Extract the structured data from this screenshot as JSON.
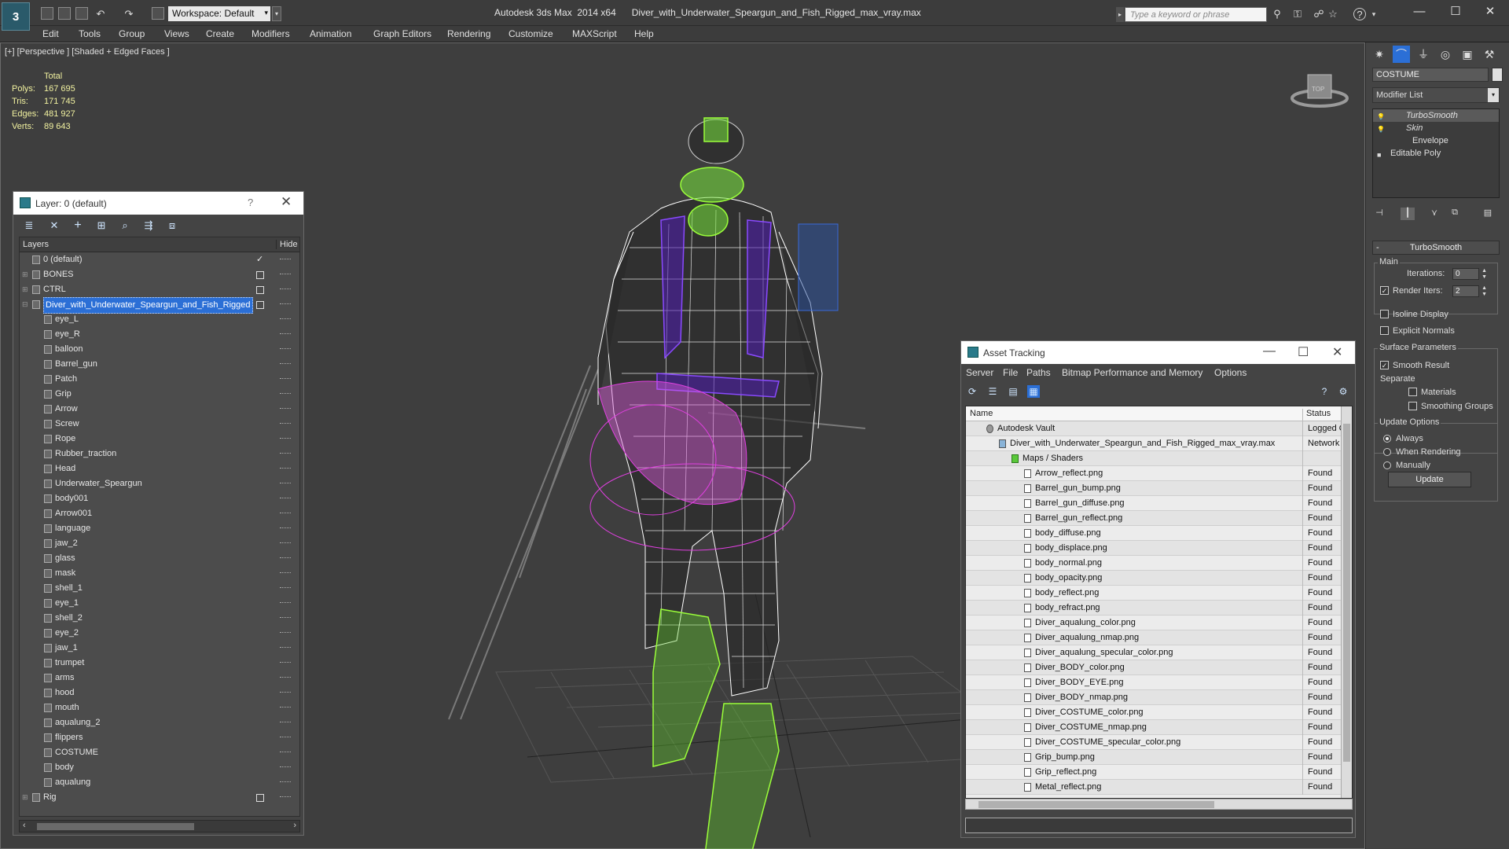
{
  "titlebar": {
    "app_title": "Autodesk 3ds Max  2014 x64      Diver_with_Underwater_Speargun_and_Fish_Rigged_max_vray.max",
    "workspace": "Workspace: Default",
    "search_placeholder": "Type a keyword or phrase",
    "logo": "3"
  },
  "menu": [
    "Edit",
    "Tools",
    "Group",
    "Views",
    "Create",
    "Modifiers",
    "Animation",
    "Graph Editors",
    "Rendering",
    "Customize",
    "MAXScript",
    "Help"
  ],
  "viewport": {
    "label": "[+] [Perspective ] [Shaded + Edged Faces ]",
    "stats": {
      "header": "Total",
      "rows": [
        {
          "k": "Polys:",
          "v": "167 695"
        },
        {
          "k": "Tris:",
          "v": "171 745"
        },
        {
          "k": "Edges:",
          "v": "481 927"
        },
        {
          "k": "Verts:",
          "v": "89 643"
        }
      ]
    },
    "viewcube_label": "TOP"
  },
  "layer_panel": {
    "title": "Layer: 0 (default)",
    "help": "?",
    "col_layers": "Layers",
    "col_hide": "Hide",
    "rows": [
      {
        "name": "0 (default)",
        "level": 0,
        "exp": "",
        "mark": "check"
      },
      {
        "name": "BONES",
        "level": 0,
        "exp": "+",
        "mark": "box"
      },
      {
        "name": "CTRL",
        "level": 0,
        "exp": "+",
        "mark": "box"
      },
      {
        "name": "Diver_with_Underwater_Speargun_and_Fish_Rigged",
        "level": 0,
        "exp": "-",
        "mark": "box",
        "selected": true
      },
      {
        "name": "eye_L",
        "level": 1
      },
      {
        "name": "eye_R",
        "level": 1
      },
      {
        "name": "balloon",
        "level": 1
      },
      {
        "name": "Barrel_gun",
        "level": 1
      },
      {
        "name": "Patch",
        "level": 1
      },
      {
        "name": "Grip",
        "level": 1
      },
      {
        "name": "Arrow",
        "level": 1
      },
      {
        "name": "Screw",
        "level": 1
      },
      {
        "name": "Rope",
        "level": 1
      },
      {
        "name": "Rubber_traction",
        "level": 1
      },
      {
        "name": "Head",
        "level": 1
      },
      {
        "name": "Underwater_Speargun",
        "level": 1
      },
      {
        "name": "body001",
        "level": 1
      },
      {
        "name": "Arrow001",
        "level": 1
      },
      {
        "name": "language",
        "level": 1
      },
      {
        "name": "jaw_2",
        "level": 1
      },
      {
        "name": "glass",
        "level": 1
      },
      {
        "name": "mask",
        "level": 1
      },
      {
        "name": "shell_1",
        "level": 1
      },
      {
        "name": "eye_1",
        "level": 1
      },
      {
        "name": "shell_2",
        "level": 1
      },
      {
        "name": "eye_2",
        "level": 1
      },
      {
        "name": "jaw_1",
        "level": 1
      },
      {
        "name": "trumpet",
        "level": 1
      },
      {
        "name": "arms",
        "level": 1
      },
      {
        "name": "hood",
        "level": 1
      },
      {
        "name": "mouth",
        "level": 1
      },
      {
        "name": "aqualung_2",
        "level": 1
      },
      {
        "name": "flippers",
        "level": 1
      },
      {
        "name": "COSTUME",
        "level": 1
      },
      {
        "name": "body",
        "level": 1
      },
      {
        "name": "aqualung",
        "level": 1
      },
      {
        "name": "Rig",
        "level": 0,
        "exp": "+",
        "mark": "box"
      }
    ]
  },
  "asset_panel": {
    "title": "Asset Tracking",
    "menu": [
      "Server",
      "File",
      "Paths",
      "Bitmap Performance and Memory",
      "Options"
    ],
    "col_name": "Name",
    "col_status": "Status",
    "rows": [
      {
        "name": "Autodesk Vault",
        "indent": 1,
        "status": "Logged O",
        "kind": "vault"
      },
      {
        "name": "Diver_with_Underwater_Speargun_and_Fish_Rigged_max_vray.max",
        "indent": 2,
        "status": "Network",
        "kind": "max"
      },
      {
        "name": "Maps / Shaders",
        "indent": 3,
        "status": "",
        "kind": "maps"
      },
      {
        "name": "Arrow_reflect.png",
        "indent": 4,
        "status": "Found"
      },
      {
        "name": "Barrel_gun_bump.png",
        "indent": 4,
        "status": "Found"
      },
      {
        "name": "Barrel_gun_diffuse.png",
        "indent": 4,
        "status": "Found"
      },
      {
        "name": "Barrel_gun_reflect.png",
        "indent": 4,
        "status": "Found"
      },
      {
        "name": "body_diffuse.png",
        "indent": 4,
        "status": "Found"
      },
      {
        "name": "body_displace.png",
        "indent": 4,
        "status": "Found"
      },
      {
        "name": "body_normal.png",
        "indent": 4,
        "status": "Found"
      },
      {
        "name": "body_opacity.png",
        "indent": 4,
        "status": "Found"
      },
      {
        "name": "body_reflect.png",
        "indent": 4,
        "status": "Found"
      },
      {
        "name": "body_refract.png",
        "indent": 4,
        "status": "Found"
      },
      {
        "name": "Diver_aqualung_color.png",
        "indent": 4,
        "status": "Found"
      },
      {
        "name": "Diver_aqualung_nmap.png",
        "indent": 4,
        "status": "Found"
      },
      {
        "name": "Diver_aqualung_specular_color.png",
        "indent": 4,
        "status": "Found"
      },
      {
        "name": "Diver_BODY_color.png",
        "indent": 4,
        "status": "Found"
      },
      {
        "name": "Diver_BODY_EYE.png",
        "indent": 4,
        "status": "Found"
      },
      {
        "name": "Diver_BODY_nmap.png",
        "indent": 4,
        "status": "Found"
      },
      {
        "name": "Diver_COSTUME_color.png",
        "indent": 4,
        "status": "Found"
      },
      {
        "name": "Diver_COSTUME_nmap.png",
        "indent": 4,
        "status": "Found"
      },
      {
        "name": "Diver_COSTUME_specular_color.png",
        "indent": 4,
        "status": "Found"
      },
      {
        "name": "Grip_bump.png",
        "indent": 4,
        "status": "Found"
      },
      {
        "name": "Grip_reflect.png",
        "indent": 4,
        "status": "Found"
      },
      {
        "name": "Metal_reflect.png",
        "indent": 4,
        "status": "Found"
      }
    ]
  },
  "command_panel": {
    "object_name": "COSTUME",
    "modifier_list": "Modifier List",
    "stack": [
      {
        "name": "TurboSmooth",
        "italic": true,
        "bulb": true,
        "sel": true
      },
      {
        "name": "Skin",
        "italic": true,
        "bulb": true
      },
      {
        "name": "Envelope",
        "sub": true
      },
      {
        "name": "Editable Poly",
        "box": true
      }
    ],
    "turbosmooth": {
      "title": "TurboSmooth",
      "main": "Main",
      "iterations_label": "Iterations:",
      "iterations": "0",
      "render_iters_label": "Render Iters:",
      "render_iters": "2",
      "isoline": "Isoline Display",
      "explicit": "Explicit Normals",
      "surface": "Surface Parameters",
      "smooth_result": "Smooth Result",
      "separate": "Separate",
      "materials": "Materials",
      "smoothing_groups": "Smoothing Groups",
      "update_options": "Update Options",
      "always": "Always",
      "when_rendering": "When Rendering",
      "manually": "Manually",
      "update": "Update"
    }
  },
  "colors": {
    "wire_white": "#ffffff",
    "wire_green": "#9bff3a",
    "wire_purple": "#6a28c8",
    "wire_magenta": "#e040e0",
    "selection_blue": "#2b6fd6"
  }
}
